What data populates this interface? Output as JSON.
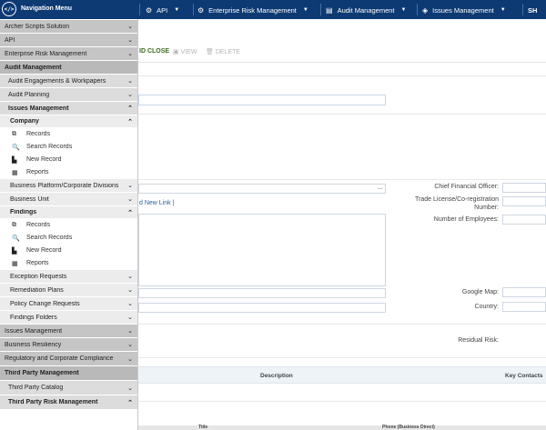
{
  "topbar": {
    "menu_label": "Navigation Menu",
    "items": [
      {
        "label": "API",
        "icon": "gear-icon"
      },
      {
        "label": "Enterprise Risk Management",
        "icon": "gear-icon"
      },
      {
        "label": "Audit Management",
        "icon": "folder-icon"
      },
      {
        "label": "Issues Management",
        "icon": "tag-icon"
      }
    ],
    "right_label": "SH"
  },
  "toolbar": {
    "save_close": "ID CLOSE",
    "view": "VIEW",
    "delete": "DELETE"
  },
  "form": {
    "cfo_label": "Chief Financial Officer:",
    "trade_label_1": "Trade License/Co-registration",
    "trade_label_2": "Number:",
    "employees_label": "Number of Employees:",
    "google_map_label": "Google Map:",
    "country_label": "Country:",
    "residual_risk_label": "Residual Risk:",
    "add_link": "d New Link |",
    "lookup_ellipsis": "..."
  },
  "grid": {
    "headers": [
      "Description",
      "Key Contacts"
    ],
    "sub_headers": [
      "Title",
      "Phone (Business Direct)"
    ]
  },
  "sidenav": {
    "rows": [
      {
        "label": "Archer Scripts Solution",
        "level": "lv0",
        "chev": "down"
      },
      {
        "label": "API",
        "level": "lv0",
        "chev": "down"
      },
      {
        "label": "Enterprise Risk Management",
        "level": "lv0",
        "chev": "down"
      },
      {
        "label": "Audit Management",
        "level": "lv0 open",
        "chev": ""
      },
      {
        "label": "Audit Engagements & Workpapers",
        "level": "lv1",
        "chev": "down"
      },
      {
        "label": "Audit Planning",
        "level": "lv1",
        "chev": "down"
      },
      {
        "label": "Issues Management",
        "level": "lv1 open",
        "chev": "up"
      },
      {
        "label": "Company",
        "level": "lv2 open",
        "chev": "up"
      },
      {
        "label": "Records",
        "level": "leaf",
        "icon": "records-icon"
      },
      {
        "label": "Search Records",
        "level": "leaf",
        "icon": "search-icon"
      },
      {
        "label": "New Record",
        "level": "leaf",
        "icon": "new-record-icon"
      },
      {
        "label": "Reports",
        "level": "leaf",
        "icon": "reports-icon"
      },
      {
        "label": "Business Platform/Corporate Divisions",
        "level": "lv2",
        "chev": "down"
      },
      {
        "label": "Business Unit",
        "level": "lv2",
        "chev": "down"
      },
      {
        "label": "Findings",
        "level": "lv2 open",
        "chev": "up"
      },
      {
        "label": "Records",
        "level": "leaf",
        "icon": "records-icon"
      },
      {
        "label": "Search Records",
        "level": "leaf",
        "icon": "search-icon"
      },
      {
        "label": "New Record",
        "level": "leaf",
        "icon": "new-record-icon"
      },
      {
        "label": "Reports",
        "level": "leaf",
        "icon": "reports-icon"
      },
      {
        "label": "Exception Requests",
        "level": "lv2",
        "chev": "down"
      },
      {
        "label": "Remediation Plans",
        "level": "lv2",
        "chev": "down"
      },
      {
        "label": "Policy Change Requests",
        "level": "lv2",
        "chev": "down"
      },
      {
        "label": "Findings Folders",
        "level": "lv2",
        "chev": "down"
      },
      {
        "label": "Issues Management",
        "level": "lv0",
        "chev": "down"
      },
      {
        "label": "Business Resiliency",
        "level": "lv0",
        "chev": "down"
      },
      {
        "label": "Regulatory and Corporate Compliance",
        "level": "lv0",
        "chev": "down"
      },
      {
        "label": "Third Party Management",
        "level": "lv0 open",
        "chev": ""
      },
      {
        "label": "Third Party Catalog",
        "level": "lv1",
        "chev": "down"
      },
      {
        "label": "Third Party Risk Management",
        "level": "lv1 open",
        "chev": "up"
      }
    ]
  }
}
